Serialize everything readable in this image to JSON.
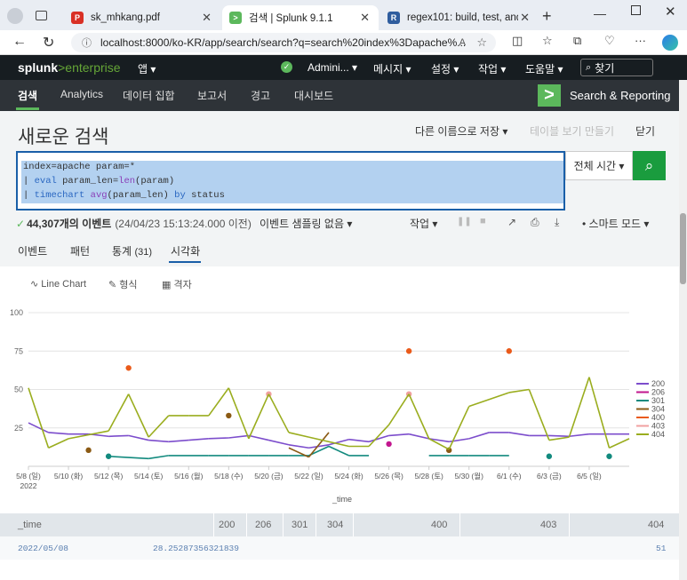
{
  "browser": {
    "tabs": [
      {
        "title": "sk_mhkang.pdf"
      },
      {
        "title": "검색 | Splunk 9.1.1"
      },
      {
        "title": "regex101: build, test, and deb"
      }
    ],
    "url": "localhost:8000/ko-KR/app/search/search?q=search%20index%3Dapache%..."
  },
  "splunk_bar": {
    "logo_a": "splunk",
    "logo_b": ">enterprise",
    "app": "앱 ▾",
    "user": "Admini... ▾",
    "messages": "메시지 ▾",
    "settings": "설정 ▾",
    "activity": "작업 ▾",
    "help": "도움말 ▾",
    "find": "찾기"
  },
  "app_bar": {
    "nav": [
      "검색",
      "Analytics",
      "데이터 집합",
      "보고서",
      "경고",
      "대시보드"
    ],
    "app_title": "Search & Reporting"
  },
  "page": {
    "title": "새로운 검색",
    "save_as": "다른 이름으로 저장 ▾",
    "create_table": "테이블 보기 만들기",
    "close": "닫기"
  },
  "search": {
    "line1": "index=apache param=*",
    "line2_pipe": "| ",
    "line2_kw": "eval",
    "line2_rest": " param_len=",
    "line2_fn": "len",
    "line2_end": "(param)",
    "line3_pipe": "| ",
    "line3_kw": "timechart",
    "line3_sp": " ",
    "line3_fn": "avg",
    "line3_mid": "(param_len) ",
    "line3_by": "by",
    "line3_end": " status",
    "time_range": "전체 시간 ▾"
  },
  "status": {
    "count": "44,307개의 이벤트",
    "before": "(24/04/23 15:13:24.000 이전)",
    "sampling": "이벤트 샘플링 없음 ▾",
    "job": "작업 ▾",
    "mode": "스마트 모드 ▾"
  },
  "result_tabs": {
    "events": "이벤트",
    "patterns": "패턴",
    "stats": "통계",
    "stats_count": "(31)",
    "viz": "시각화"
  },
  "viz_toolbar": {
    "chart_type": "Line Chart",
    "format": "형식",
    "trellis": "격자"
  },
  "chart_data": {
    "type": "line",
    "xlabel": "_time",
    "ylim": [
      0,
      100
    ],
    "y_ticks": [
      "100",
      "75",
      "50",
      "25"
    ],
    "x_ticks": [
      "5/8 (일)",
      "5/10 (화)",
      "5/12 (목)",
      "5/14 (토)",
      "5/16 (월)",
      "5/18 (수)",
      "5/20 (금)",
      "5/22 (일)",
      "5/24 (화)",
      "5/26 (목)",
      "5/28 (토)",
      "5/30 (월)",
      "6/1 (수)",
      "6/3 (금)",
      "6/5 (일)"
    ],
    "x_year": "2022",
    "legend_position": "right",
    "series": [
      {
        "name": "200",
        "color": "#7c4dcc",
        "style": "line",
        "points": [
          [
            0,
            28.3
          ],
          [
            1,
            22
          ],
          [
            2,
            21
          ],
          [
            3,
            21
          ],
          [
            4,
            19.5
          ],
          [
            5,
            20
          ],
          [
            6,
            17
          ],
          [
            7,
            16
          ],
          [
            8,
            17
          ],
          [
            9,
            18
          ],
          [
            10,
            18.5
          ],
          [
            11,
            20
          ],
          [
            12,
            17
          ],
          [
            13,
            14
          ],
          [
            14,
            12
          ],
          [
            15,
            14
          ],
          [
            16,
            17.5
          ],
          [
            17,
            16
          ],
          [
            18,
            20
          ],
          [
            19,
            21
          ],
          [
            20,
            18
          ],
          [
            21,
            16
          ],
          [
            22,
            18
          ],
          [
            23,
            22
          ],
          [
            24,
            22
          ],
          [
            25,
            20
          ],
          [
            26,
            20
          ],
          [
            27,
            19.5
          ],
          [
            28,
            21
          ],
          [
            29,
            21
          ],
          [
            30,
            21
          ]
        ]
      },
      {
        "name": "206",
        "color": "#c2168e",
        "style": "dots",
        "points": [
          [
            18,
            14.5
          ]
        ]
      },
      {
        "name": "301",
        "color": "#128a7e",
        "style": "mixed",
        "points": [
          [
            4,
            6.5
          ],
          [
            6,
            5
          ],
          [
            7,
            7
          ],
          [
            9,
            7
          ],
          [
            10,
            7
          ],
          [
            11,
            7
          ],
          [
            12,
            7
          ],
          [
            13,
            7
          ],
          [
            14,
            7
          ],
          [
            15,
            13
          ],
          [
            16,
            7
          ],
          [
            17,
            7
          ],
          [
            20,
            7
          ],
          [
            21,
            7
          ],
          [
            22,
            7
          ],
          [
            23,
            7
          ],
          [
            24,
            7
          ]
        ],
        "dots": [
          [
            4,
            6.5
          ],
          [
            26,
            6.5
          ],
          [
            29,
            6.5
          ]
        ]
      },
      {
        "name": "304",
        "color": "#8b5a14",
        "style": "mixed",
        "points": [
          [
            13,
            12
          ],
          [
            14,
            6
          ],
          [
            15,
            22
          ]
        ],
        "dots": [
          [
            3,
            10.5
          ],
          [
            10,
            33
          ],
          [
            21,
            10.5
          ]
        ]
      },
      {
        "name": "400",
        "color": "#ea5a1a",
        "style": "dots",
        "points": [
          [
            5,
            64
          ],
          [
            19,
            75
          ],
          [
            24,
            75
          ]
        ]
      },
      {
        "name": "403",
        "color": "#f0a0a0",
        "style": "dots",
        "points": [
          [
            12,
            47
          ],
          [
            19,
            47
          ]
        ]
      },
      {
        "name": "404",
        "color": "#9aad1e",
        "style": "line",
        "points": [
          [
            0,
            51
          ],
          [
            1,
            12
          ],
          [
            2,
            18
          ],
          [
            4,
            23
          ],
          [
            5,
            47
          ],
          [
            6,
            19
          ],
          [
            7,
            33
          ],
          [
            8,
            33
          ],
          [
            9,
            33
          ],
          [
            10,
            51
          ],
          [
            11,
            18
          ],
          [
            12,
            47
          ],
          [
            13,
            22
          ],
          [
            14,
            19
          ],
          [
            16,
            13
          ],
          [
            17,
            13
          ],
          [
            18,
            27
          ],
          [
            19,
            47
          ],
          [
            20,
            18
          ],
          [
            21,
            11
          ],
          [
            22,
            39
          ],
          [
            24,
            48
          ],
          [
            25,
            50
          ],
          [
            26,
            17
          ],
          [
            27,
            19
          ],
          [
            28,
            58
          ],
          [
            29,
            12
          ],
          [
            30,
            18
          ]
        ]
      }
    ]
  },
  "table": {
    "headers": [
      "_time",
      "200",
      "206",
      "301",
      "304",
      "400",
      "403",
      "404"
    ],
    "row": [
      "2022/05/08",
      "28.25287356321839",
      "",
      "",
      "",
      "",
      "",
      "51"
    ]
  }
}
